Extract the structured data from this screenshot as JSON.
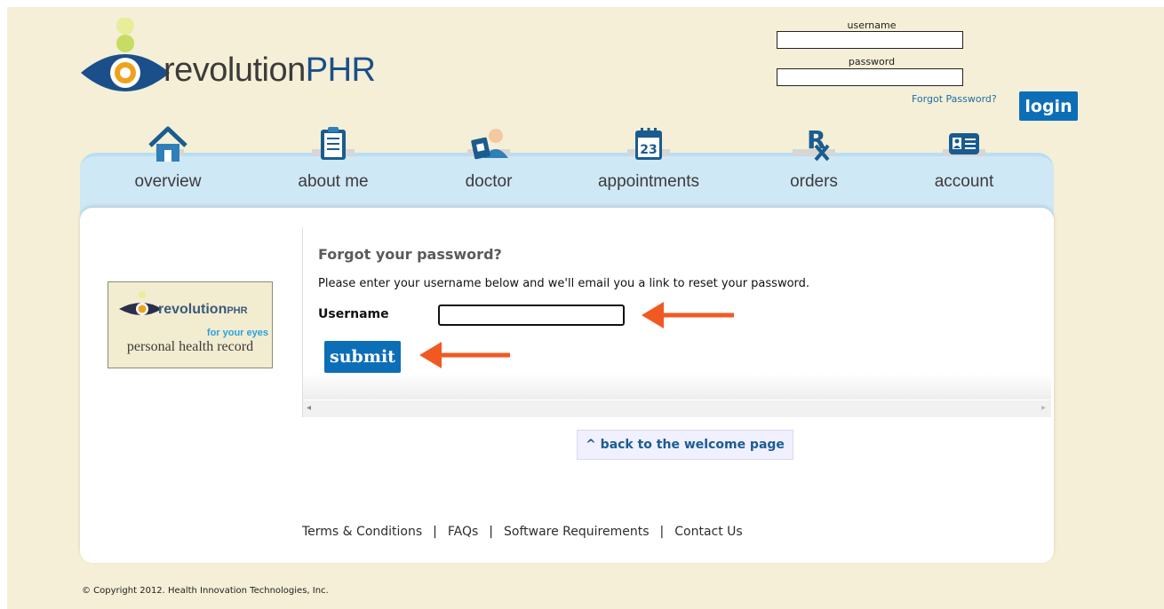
{
  "brand": {
    "name_prefix": "revolution",
    "name_suffix": "PHR"
  },
  "login": {
    "username_label": "username",
    "password_label": "password",
    "forgot_link": "Forgot Password?",
    "login_button": "login"
  },
  "nav": {
    "items": [
      {
        "label": "overview",
        "icon": "house-icon"
      },
      {
        "label": "about me",
        "icon": "clipboard-icon"
      },
      {
        "label": "doctor",
        "icon": "doctor-icon"
      },
      {
        "label": "appointments",
        "icon": "calendar-icon",
        "icon_text": "23"
      },
      {
        "label": "orders",
        "icon": "rx-icon",
        "icon_text": "R"
      },
      {
        "label": "account",
        "icon": "id-card-icon"
      }
    ]
  },
  "side_logo": {
    "brand": "revolution",
    "brand_suffix": "PHR",
    "tagline": "for your eyes",
    "subtitle": "personal health record"
  },
  "forgot_form": {
    "heading": "Forgot your password?",
    "instructions": "Please enter your username below and we'll email you a link to reset your password.",
    "username_label": "Username",
    "username_value": "",
    "submit_label": "submit"
  },
  "back_link": "^ back to the welcome page",
  "footer": {
    "links": [
      "Terms & Conditions",
      "FAQs",
      "Software Requirements",
      "Contact Us"
    ],
    "copyright": "© Copyright 2012. Health Innovation Technologies, Inc."
  },
  "colors": {
    "background": "#f4efd6",
    "primary_button": "#0d6eb8",
    "nav_bar": "#cfe8f6",
    "arrow": "#f05a22",
    "link": "#1c6ea4"
  }
}
